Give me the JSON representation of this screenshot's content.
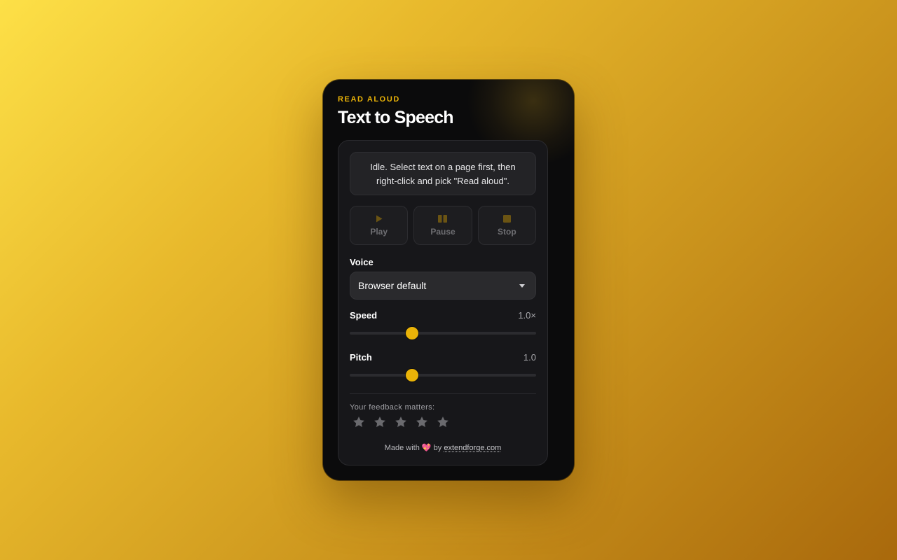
{
  "header": {
    "eyebrow": "READ ALOUD",
    "title": "Text to Speech"
  },
  "status": {
    "line1": "Idle. Select text on a page first, then",
    "line2": "right-click and pick \"Read aloud\"."
  },
  "controls": [
    {
      "label": "Play",
      "icon": "play-icon"
    },
    {
      "label": "Pause",
      "icon": "pause-icon"
    },
    {
      "label": "Stop",
      "icon": "stop-icon"
    }
  ],
  "voice": {
    "label": "Voice",
    "selected": "Browser default"
  },
  "speed": {
    "label": "Speed",
    "display": "1.0×",
    "value": 1.0,
    "min": 0.5,
    "max": 2.0
  },
  "pitch": {
    "label": "Pitch",
    "display": "1.0",
    "value": 1.0,
    "min": 0.5,
    "max": 2.0
  },
  "feedback": {
    "label": "Your feedback matters:",
    "rating": 0,
    "max": 5
  },
  "footer": {
    "prefix": "Made with",
    "heart": "💖",
    "by": "by",
    "link": "extendforge.com"
  },
  "colors": {
    "accent": "#eab308",
    "panel": "#17171a",
    "card": "#0b0b0c"
  }
}
